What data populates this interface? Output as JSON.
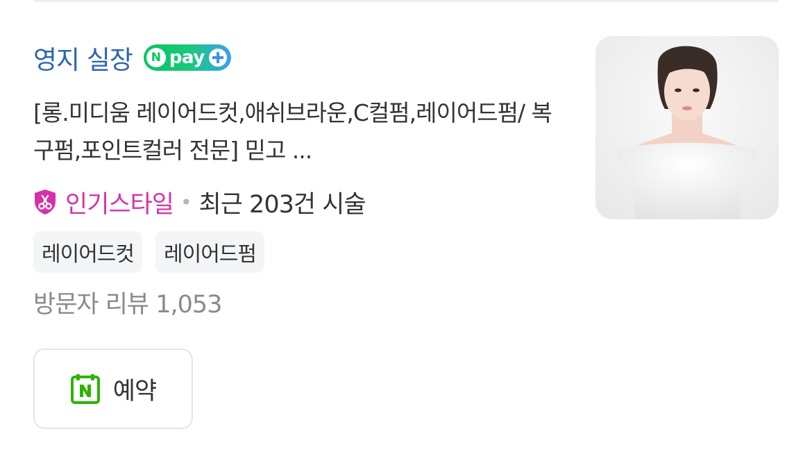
{
  "listing": {
    "name": "영지 실장",
    "npay_label": "pay",
    "description": "[롱.미디움 레이어드컷,애쉬브라운,C컬펌,레이어드펌/ 복구펌,포인트컬러 전문] 믿고 ...",
    "popular_badge": "인기스타일",
    "separator": "•",
    "recent_count": "최근 203건 시술",
    "tags": [
      "레이어드컷",
      "레이어드펌"
    ],
    "visitor_reviews": "방문자 리뷰 1,053",
    "reserve_button": "예약"
  },
  "colors": {
    "title": "#2e64b4",
    "popular": "#d432a9",
    "npay_green": "#03c75a",
    "naver_booking_green": "#2db400"
  },
  "icons": {
    "npay": "npay-plus-icon",
    "popular": "scissors-shield-icon",
    "booking": "naver-calendar-icon"
  }
}
